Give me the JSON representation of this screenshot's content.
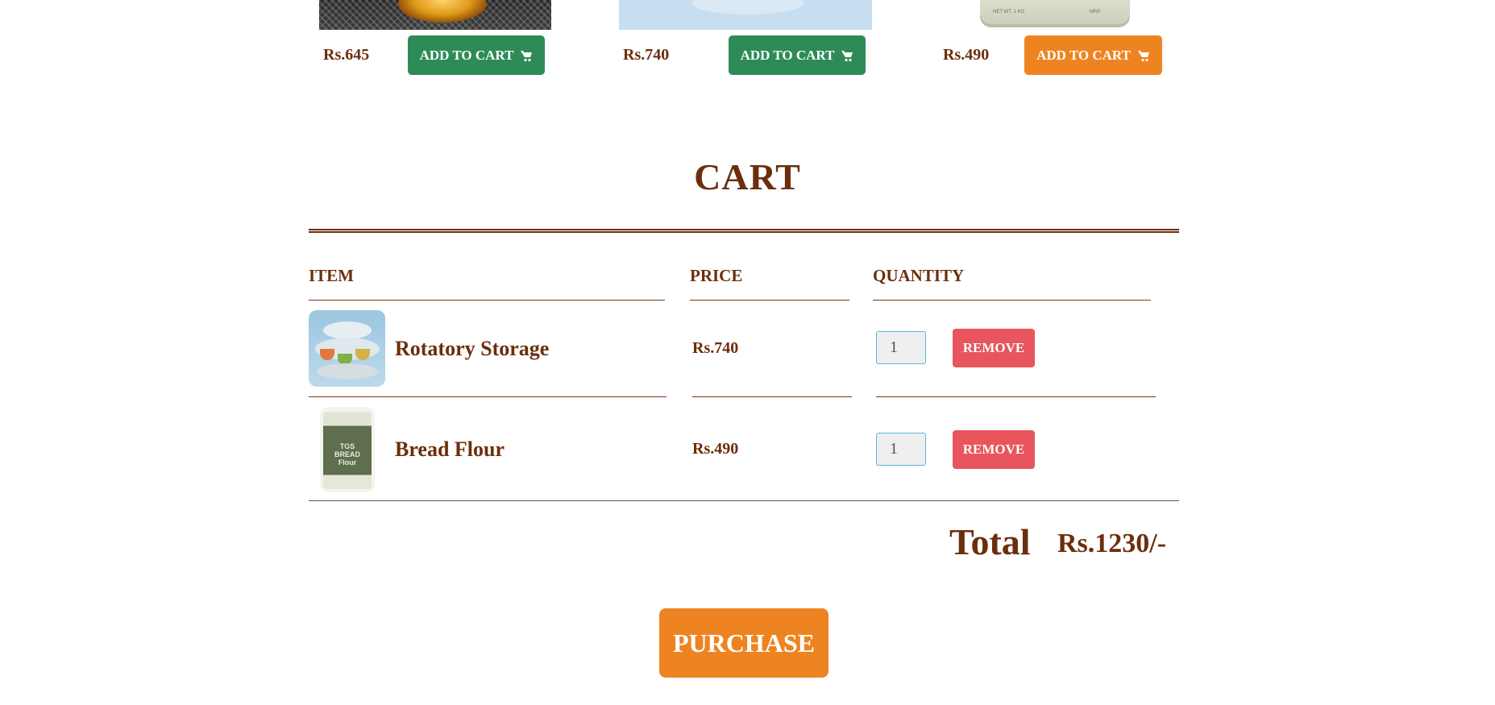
{
  "products": [
    {
      "price": "Rs.645",
      "button_label": "ADD TO CART",
      "button_color": "#2e8b57"
    },
    {
      "price": "Rs.740",
      "button_label": "ADD TO CART",
      "button_color": "#2e8b57"
    },
    {
      "price": "Rs.490",
      "button_label": "ADD TO CART",
      "button_color": "#ee8421"
    }
  ],
  "cart": {
    "title": "CART",
    "headers": {
      "item": "ITEM",
      "price": "PRICE",
      "quantity": "QUANTITY"
    },
    "items": [
      {
        "name": "Rotatory Storage",
        "price": "Rs.740",
        "quantity": "1",
        "remove_label": "REMOVE"
      },
      {
        "name": "Bread Flour",
        "price": "Rs.490",
        "quantity": "1",
        "remove_label": "REMOVE"
      }
    ],
    "total_label": "Total",
    "total_value": "Rs.1230/-",
    "purchase_label": "PURCHASE"
  },
  "colors": {
    "text": "#6b2e0c",
    "green": "#2e8b57",
    "orange": "#ee8421",
    "remove": "#e8555c"
  },
  "icons": [
    "shopping-cart-icon"
  ]
}
